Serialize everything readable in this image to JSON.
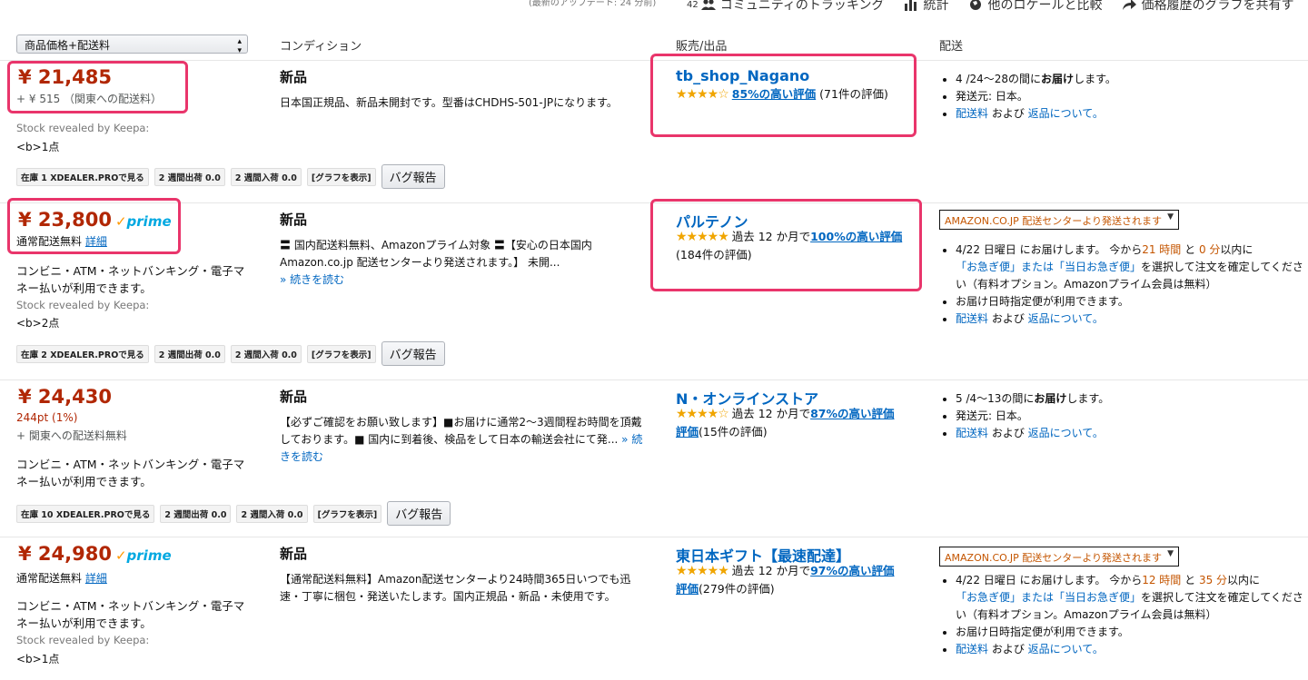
{
  "topbar": {
    "update": "(最新のアップデート: 24 分前)",
    "community_count": "42",
    "community": "コミュニティのトラッキング",
    "stats": "統計",
    "locale": "他のロケールと比較",
    "share": "価格履歴のグラフを共有す"
  },
  "header": {
    "sort": "商品価格+配送料",
    "condition": "コンディション",
    "seller": "販売/出品",
    "shipping": "配送"
  },
  "colors": {
    "price": "#b12704",
    "link": "#0066c0",
    "highlight": "#e9356b",
    "prime": "#00a8e1",
    "star": "#f0a500"
  },
  "keepa": {
    "stock_revealed": "Stock revealed by Keepa:",
    "graph": "[グラフを表示]",
    "bug": "バグ報告",
    "out2w": "2 週間出荷 0.0",
    "in2w": "2 週間入荷 0.0"
  },
  "common": {
    "payment": "コンビニ・ATM・ネットバンキング・電子マネー払いが利用できます。",
    "read_more": "» 続きを読む",
    "shipping_cost": "配送料",
    "and": " および ",
    "returns": "返品について。",
    "prime": "prime",
    "normal_free": "通常配送無料",
    "details": "詳細",
    "past12": "過去 12 か月で",
    "amazon_ship": "AMAZON.CO.JP 配送センターより発送されます"
  },
  "rows": [
    {
      "price": "¥ 21,485",
      "sub": "+ ¥ 515 （関東への配送料）",
      "stock": "<b>1点",
      "kstock": "在庫 1 XDEALER.PROで見る",
      "condition": "新品",
      "desc": "日本国正規品、新品未開封です。型番はCHDHS-501-JPになります。",
      "seller": "tb_shop_Nagano",
      "rate_link": "85%の高い評価",
      "rate_count": "(71件の評価)",
      "ship1": "4 /24～28の間に",
      "ship1b": "お届け",
      "ship1c": "します。",
      "ship2": "発送元: 日本。"
    },
    {
      "price": "¥ 23,800",
      "stock": "<b>2点",
      "kstock": "在庫 2 XDEALER.PROで見る",
      "condition": "新品",
      "desc": "〓 国内配送料無料、Amazonプライム対象 〓【安心の日本国内Amazon.co.jp 配送センターより発送されます。】 未開...",
      "seller": "パルテノン",
      "rate_link": "100%の高い評価",
      "rate_count": "(184件の評価)",
      "d1": "4/22 日曜日 にお届けします。 今から",
      "d1h": "21 時間",
      "d1m": "0 分",
      "d1e": "以内に",
      "d2": "「お急ぎ便」または「当日お急ぎ便」",
      "d2e": "を選択して注文を確定してください（有料オプション。Amazonプライム会員は無料）",
      "d3": "お届け日時指定便が利用できます。"
    },
    {
      "price": "¥ 24,430",
      "pt": "244pt (1%)",
      "sub": "+ 関東への配送料無料",
      "kstock": "在庫 10 XDEALER.PROで見る",
      "condition": "新品",
      "desc": "【必ずご確認をお願い致します】■お届けに通常2～3週間程お時間を頂戴しております。■ 国内に到着後、検品をして日本の輸送会社にて発...",
      "seller": "N・オンラインストア",
      "rate_link": "87%の高い評価",
      "rate_count": "(15件の評価)",
      "ship1": "5 /4～13の間に",
      "ship1b": "お届け",
      "ship1c": "します。",
      "ship2": "発送元: 日本。"
    },
    {
      "price": "¥ 24,980",
      "stock": "<b>1点",
      "condition": "新品",
      "desc": "【通常配送料無料】Amazon配送センターより24時間365日いつでも迅速・丁寧に梱包・発送いたします。国内正規品・新品・未使用です。",
      "seller": "東日本ギフト【最速配達】",
      "rate_link": "97%の高い評価",
      "rate_count": "(279件の評価)",
      "d1": "4/22 日曜日 にお届けします。 今から",
      "d1h": "12 時間",
      "d1m": "35 分",
      "d1e": "以内に",
      "d2": "「お急ぎ便」または「当日お急ぎ便」",
      "d2e": "を選択して注文を確定してください（有料オプション。Amazonプライム会員は無料）",
      "d3": "お届け日時指定便が利用できます。"
    }
  ]
}
